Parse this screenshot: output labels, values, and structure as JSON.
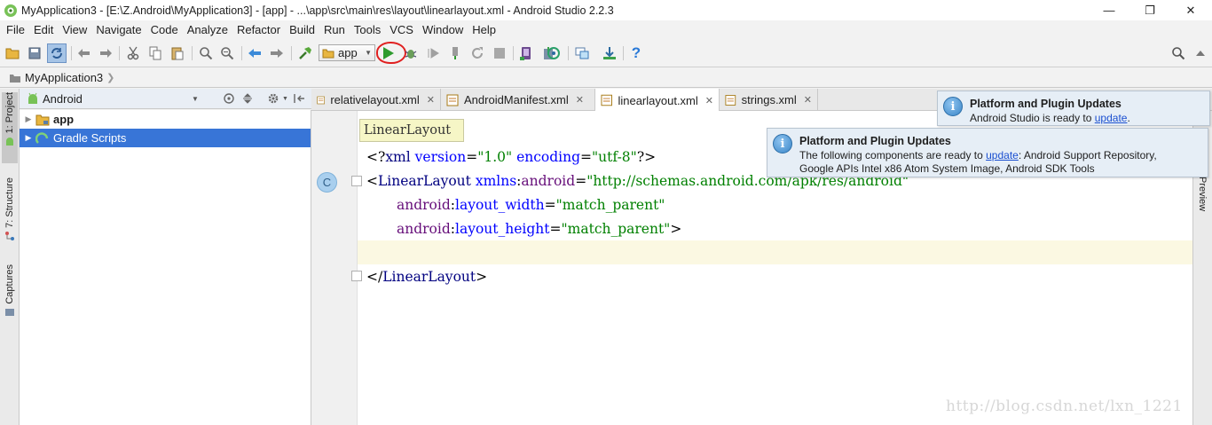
{
  "window": {
    "title": "MyApplication3 - [E:\\Z.Android\\MyApplication3] - [app] - ...\\app\\src\\main\\res\\layout\\linearlayout.xml - Android Studio 2.2.3",
    "minimize": "—",
    "maximize": "❐",
    "close": "✕"
  },
  "menu": [
    "File",
    "Edit",
    "View",
    "Navigate",
    "Code",
    "Analyze",
    "Refactor",
    "Build",
    "Run",
    "Tools",
    "VCS",
    "Window",
    "Help"
  ],
  "toolbar": {
    "run_config": "app",
    "help_glyph": "?",
    "search_icon": "search-icon",
    "colors": {
      "run": "#2e9b2e",
      "highlight_circle": "#e02020"
    }
  },
  "breadcrumb": {
    "project": "MyApplication3"
  },
  "left_strip": {
    "project_tab": "1: Project",
    "structure_tab": "7: Structure",
    "captures_tab": "Captures"
  },
  "project_panel": {
    "view": "Android",
    "tree": [
      {
        "label": "app",
        "bold": true,
        "selected": false
      },
      {
        "label": "Gradle Scripts",
        "bold": false,
        "selected": true
      }
    ]
  },
  "editor": {
    "tabs": [
      {
        "label": "relativelayout.xml",
        "active": false
      },
      {
        "label": "AndroidManifest.xml",
        "active": false
      },
      {
        "label": "linearlayout.xml",
        "active": true
      },
      {
        "label": "strings.xml",
        "active": false
      }
    ],
    "tooltip": "LinearLayout",
    "gutter_marker": "C",
    "code": {
      "l1_open": "<?",
      "l1_tag": "xml",
      "l1_version_attr": "version",
      "l1_version_val": "\"1.0\"",
      "l1_encoding_attr": "encoding",
      "l1_encoding_val": "\"utf-8\"",
      "l1_close": "?>",
      "l2_tag": "LinearLayout",
      "l2_attr_ns": "xmlns",
      "l2_attr_name": "android",
      "l2_val": "\"http://schemas.android.com/apk/res/android\"",
      "l3_ns": "android",
      "l3_attr": "layout_width",
      "l3_val": "\"match_parent\"",
      "l4_ns": "android",
      "l4_attr": "layout_height",
      "l4_val": "\"match_parent\"",
      "l6_tag": "LinearLayout"
    },
    "colors": {
      "tag": "#000080",
      "attr": "#0000ff",
      "value": "#008000",
      "current_line": "#fbf8e2"
    }
  },
  "right_strip": {
    "preview_tab": "Preview"
  },
  "notifications": [
    {
      "title": "Platform and Plugin Updates",
      "body_before": "Android Studio is ready to ",
      "link": "update",
      "body_after": "."
    },
    {
      "title": "Platform and Plugin Updates",
      "body_before": "The following components are ready to ",
      "link": "update",
      "body_after": ": Android Support Repository,",
      "body_line2": "Google APIs Intel x86 Atom System Image, Android SDK Tools"
    }
  ],
  "watermark": "http://blog.csdn.net/lxn_1221"
}
